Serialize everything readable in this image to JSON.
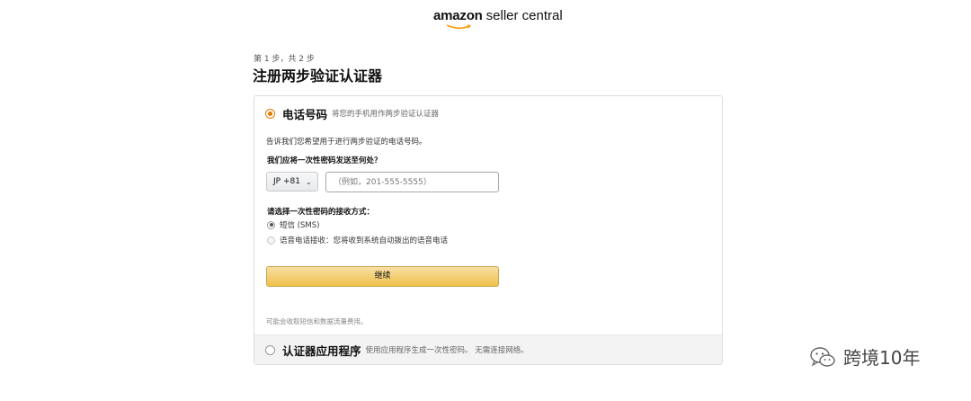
{
  "header": {
    "logo_brand": "amazon",
    "logo_product": "seller central"
  },
  "page": {
    "step_text": "第 1 步，共 2 步",
    "title": "注册两步验证认证器"
  },
  "phone_section": {
    "title": "电话号码",
    "subtitle": "将您的手机用作两步验证认证器",
    "description": "告诉我们您希望用于进行两步验证的电话号码。",
    "send_question": "我们应将一次性密码发送至何处？",
    "country_code": "JP +81",
    "phone_placeholder": "（例如，201-555-5555）",
    "phone_value": "",
    "method_question": "请选择一次性密码的接收方式：",
    "options": [
      {
        "label": "短信 (SMS)",
        "selected": true
      },
      {
        "label": "语音电话接收：您将收到系统自动拨出的语音电话",
        "selected": false
      }
    ],
    "continue_label": "继续",
    "fee_note": "可能会收取短信和数据流量费用。"
  },
  "app_section": {
    "title": "认证器应用程序",
    "subtitle": "使用应用程序生成一次性密码。 无需连接网络。"
  },
  "watermark": {
    "text": "跨境10年",
    "icon": "wechat-icon"
  },
  "colors": {
    "accent": "#e77600",
    "button_top": "#f7dfa5",
    "button_bottom": "#f0c14b",
    "section_bg": "#f3f3f3"
  }
}
